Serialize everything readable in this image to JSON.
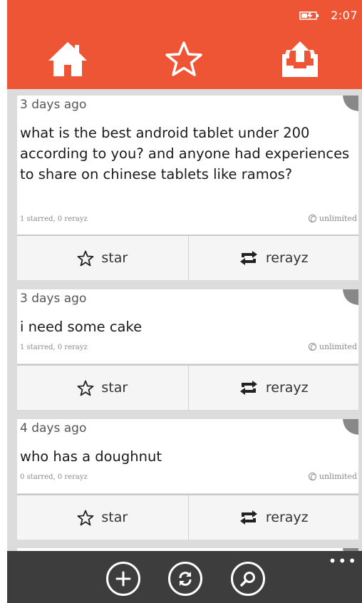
{
  "status": {
    "time": "2:07"
  },
  "colors": {
    "accent": "#ee5535",
    "bottombar": "#3d3d3d"
  },
  "nav": {
    "items": [
      {
        "icon": "home-icon"
      },
      {
        "icon": "star-outline-icon"
      },
      {
        "icon": "inbox-upload-icon"
      }
    ]
  },
  "posts": [
    {
      "time": "3 days ago",
      "text": "what is the best android tablet under 200 according to you? and anyone had experiences to share on chinese tablets like ramos?",
      "stats": "1 starred,  0 rerayz",
      "limit": "unlimited",
      "star_label": "star",
      "rerayz_label": "rerayz"
    },
    {
      "time": "3 days ago",
      "text": "i need some cake",
      "stats": "1 starred,  0 rerayz",
      "limit": "unlimited",
      "star_label": "star",
      "rerayz_label": "rerayz"
    },
    {
      "time": "4 days ago",
      "text": "who has a doughnut",
      "stats": "0 starred,  0 rerayz",
      "limit": "unlimited",
      "star_label": "star",
      "rerayz_label": "rerayz"
    }
  ],
  "bottom_bar": {
    "buttons": [
      {
        "icon": "add-icon"
      },
      {
        "icon": "refresh-icon"
      },
      {
        "icon": "search-icon"
      }
    ],
    "more": "•••"
  }
}
